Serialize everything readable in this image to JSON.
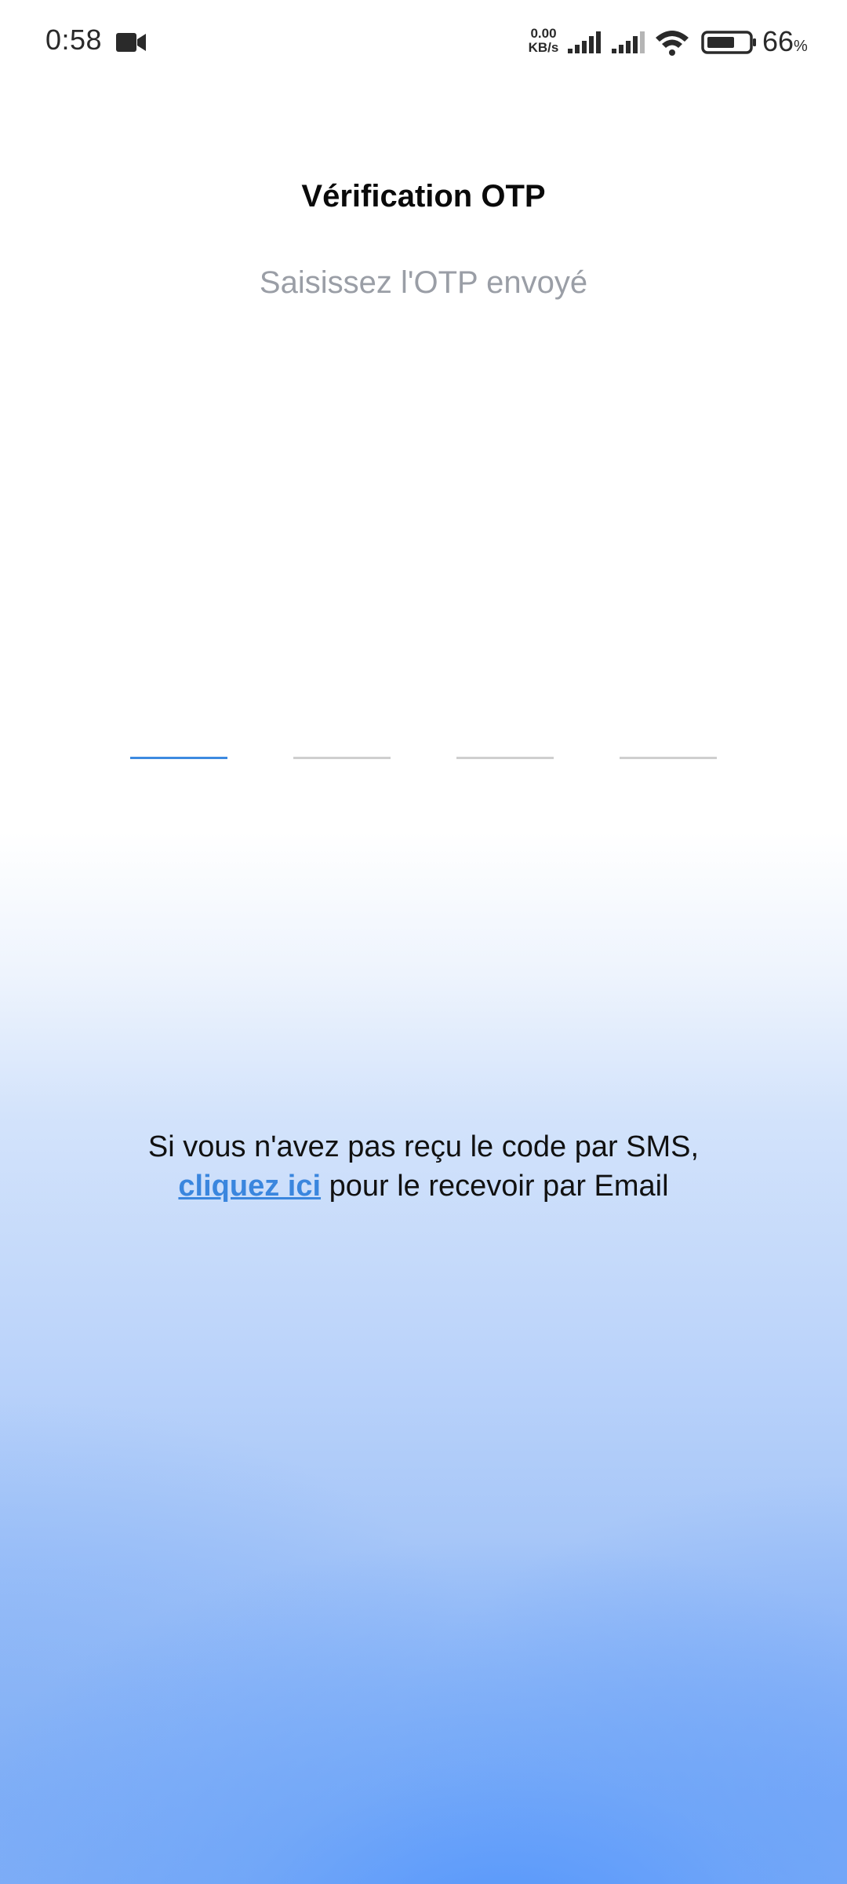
{
  "status_bar": {
    "time": "0:58",
    "net_speed_value": "0.00",
    "net_speed_unit": "KB/s",
    "battery_percent": "66",
    "battery_unit": "%",
    "battery_level": 0.66,
    "icons": [
      "video-camera-icon",
      "signal-icon",
      "signal-icon",
      "wifi-icon",
      "battery-icon"
    ]
  },
  "header": {
    "title": "Vérification OTP",
    "subtitle": "Saisissez l'OTP envoyé"
  },
  "otp": {
    "digits": [
      "",
      "",
      "",
      ""
    ],
    "active_index": 0
  },
  "resend": {
    "line1": "Si vous n'avez pas reçu le code par SMS,",
    "link_label": "cliquez ici",
    "line2_rest": " pour le recevoir par Email"
  },
  "colors": {
    "accent": "#3a86de",
    "title": "#0a0a0a",
    "subtitle": "#9a9ea6",
    "gradient_bottom": "#5a96f6"
  }
}
